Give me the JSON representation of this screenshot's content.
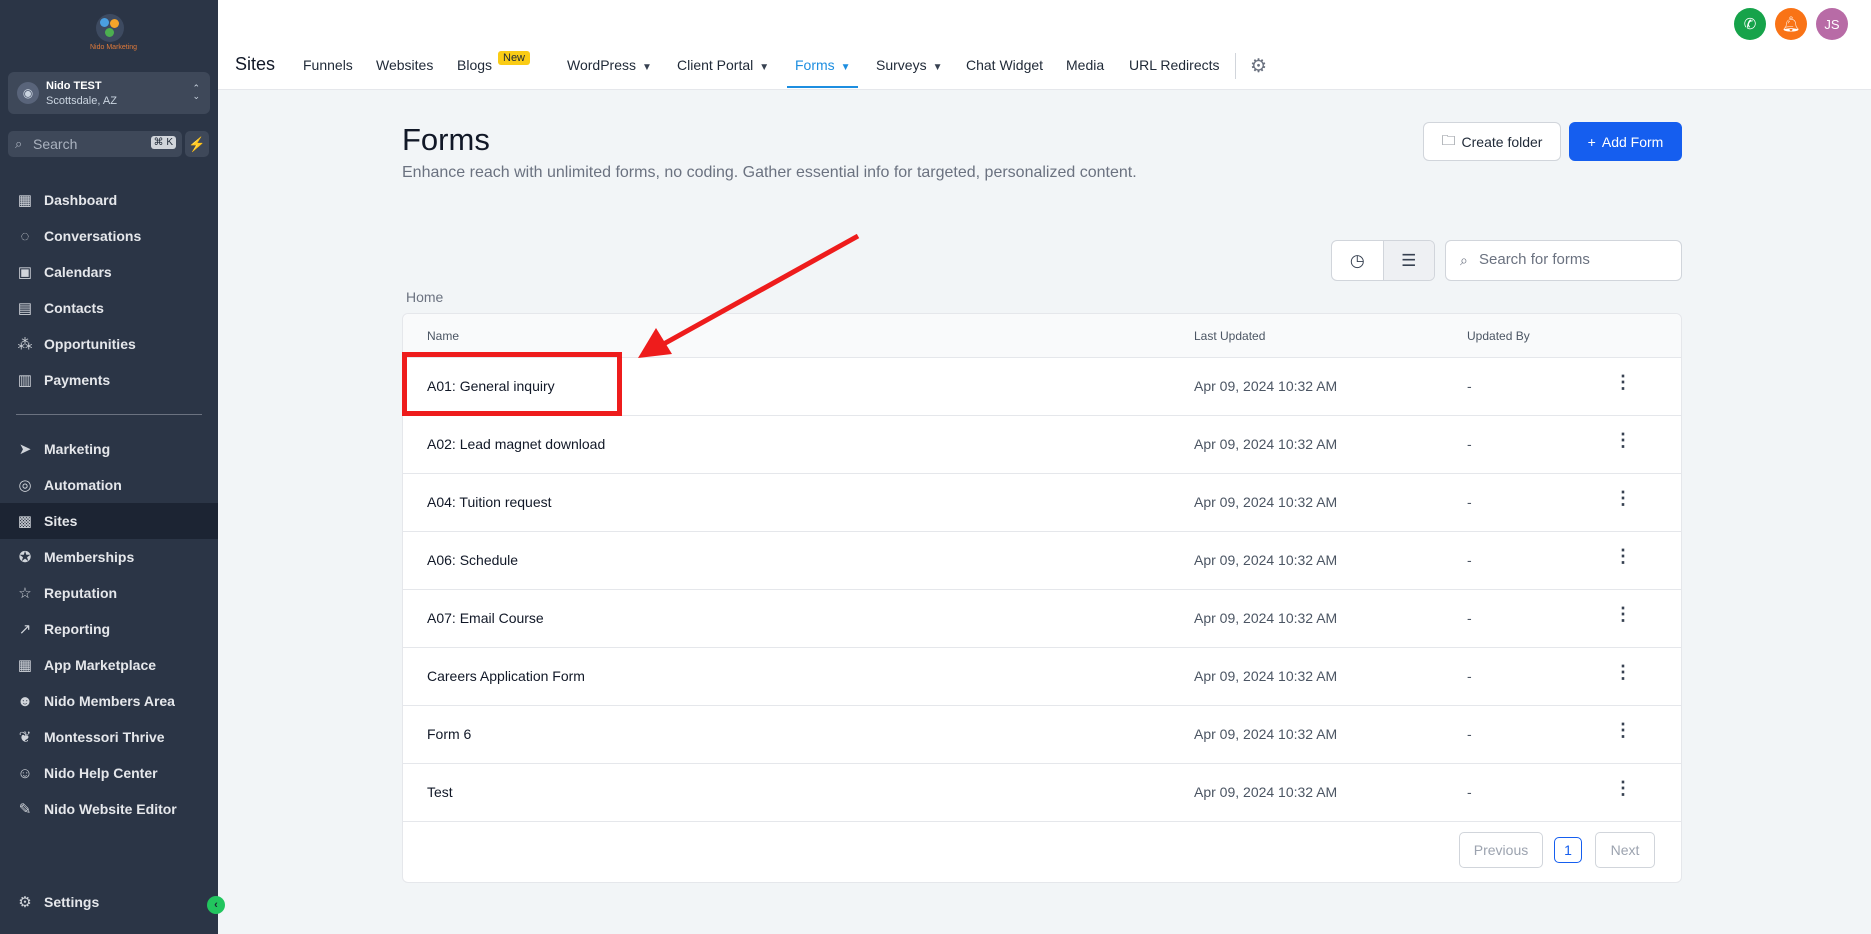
{
  "sidebar": {
    "brand": "Nido Marketing",
    "account": {
      "name": "Nido TEST",
      "location": "Scottsdale, AZ"
    },
    "search": {
      "placeholder": "Search",
      "shortcut": "⌘ K"
    },
    "items_top": [
      {
        "label": "Dashboard",
        "icon": "dashboard-icon"
      },
      {
        "label": "Conversations",
        "icon": "chat-icon"
      },
      {
        "label": "Calendars",
        "icon": "calendar-icon"
      },
      {
        "label": "Contacts",
        "icon": "contacts-icon"
      },
      {
        "label": "Opportunities",
        "icon": "opportunities-icon"
      },
      {
        "label": "Payments",
        "icon": "payments-icon"
      }
    ],
    "items_bottom": [
      {
        "label": "Marketing",
        "icon": "send-icon"
      },
      {
        "label": "Automation",
        "icon": "automation-icon"
      },
      {
        "label": "Sites",
        "icon": "sites-icon",
        "active": true
      },
      {
        "label": "Memberships",
        "icon": "award-icon"
      },
      {
        "label": "Reputation",
        "icon": "star-icon"
      },
      {
        "label": "Reporting",
        "icon": "trend-icon"
      },
      {
        "label": "App Marketplace",
        "icon": "grid-icon"
      },
      {
        "label": "Nido Members Area",
        "icon": "users-icon"
      },
      {
        "label": "Montessori Thrive",
        "icon": "leaf-icon"
      },
      {
        "label": "Nido Help Center",
        "icon": "help-users-icon"
      },
      {
        "label": "Nido Website Editor",
        "icon": "wrench-icon"
      }
    ],
    "settings_label": "Settings"
  },
  "topbar": {
    "title": "Sites",
    "tabs": [
      "Funnels",
      "Websites",
      "Blogs",
      "WordPress",
      "Client Portal",
      "Forms",
      "Surveys",
      "Chat Widget",
      "Media",
      "URL Redirects"
    ],
    "new_badge": "New",
    "user_initials": "JS",
    "colors": {
      "phone": "#16a34a",
      "bell": "#f97316",
      "avatar": "#b86ba6"
    }
  },
  "main": {
    "title": "Forms",
    "description": "Enhance reach with unlimited forms, no coding. Gather essential info for targeted, personalized content.",
    "create_folder_label": "Create folder",
    "add_form_label": "Add Form",
    "search_placeholder": "Search for forms",
    "breadcrumb": "Home",
    "columns": [
      "Name",
      "Last Updated",
      "Updated By"
    ],
    "rows": [
      {
        "name": "A01: General inquiry",
        "updated": "Apr 09, 2024 10:32 AM",
        "by": "-"
      },
      {
        "name": "A02: Lead magnet download",
        "updated": "Apr 09, 2024 10:32 AM",
        "by": "-"
      },
      {
        "name": "A04: Tuition request",
        "updated": "Apr 09, 2024 10:32 AM",
        "by": "-"
      },
      {
        "name": "A06: Schedule",
        "updated": "Apr 09, 2024 10:32 AM",
        "by": "-"
      },
      {
        "name": "A07: Email Course",
        "updated": "Apr 09, 2024 10:32 AM",
        "by": "-"
      },
      {
        "name": "Careers Application Form",
        "updated": "Apr 09, 2024 10:32 AM",
        "by": "-"
      },
      {
        "name": "Form 6",
        "updated": "Apr 09, 2024 10:32 AM",
        "by": "-"
      },
      {
        "name": "Test",
        "updated": "Apr 09, 2024 10:32 AM",
        "by": "-"
      }
    ],
    "pagination": {
      "previous": "Previous",
      "page": "1",
      "next": "Next"
    },
    "accent": "#155eef",
    "annotation_color": "#ee1c1c"
  }
}
